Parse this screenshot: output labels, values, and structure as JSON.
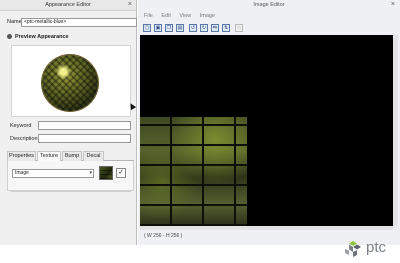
{
  "appearance_editor": {
    "title": "Appearance Editor",
    "close_glyph": "×",
    "name_label": "Name",
    "name_value": "<ptc-metallic-blue>",
    "preview_heading": "Preview Appearance",
    "keyword_label": "Keyword",
    "description_label": "Description",
    "tabs": [
      {
        "label": "Properties",
        "active": false
      },
      {
        "label": "Texture",
        "active": true
      },
      {
        "label": "Bump",
        "active": false
      },
      {
        "label": "Decal",
        "active": false
      }
    ],
    "texture_type": "Image",
    "select_arrow": "▾",
    "apply_glyph": "✓"
  },
  "image_editor": {
    "title": "Image Editor",
    "close_glyph": "×",
    "menu": [
      "File",
      "Edit",
      "View",
      "Image"
    ],
    "status": "( W 256 - H 256 )"
  },
  "logo": {
    "text": "ptc"
  }
}
